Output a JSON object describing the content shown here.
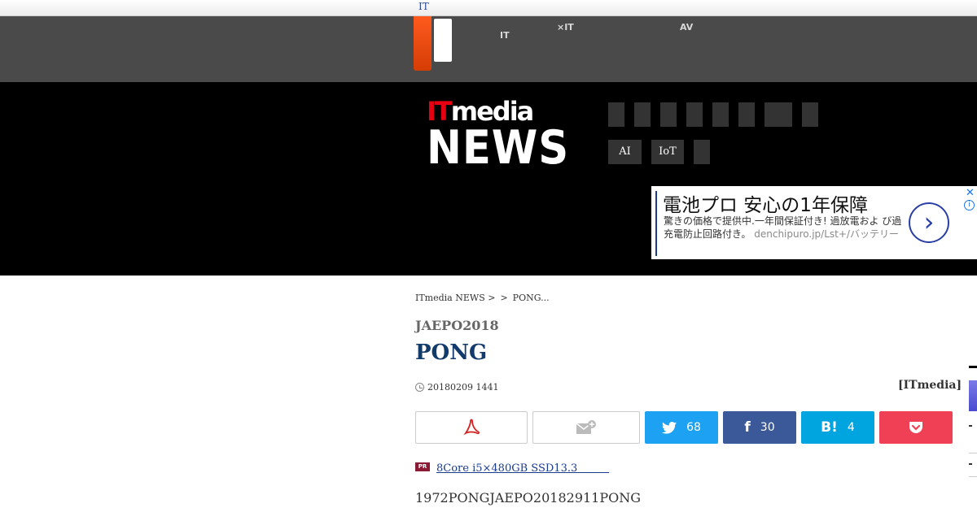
{
  "topbar": {
    "it_label": "IT"
  },
  "nav": {
    "items": [
      {
        "line1": "",
        "line2": "IT"
      },
      {
        "line1": "",
        "line2": "×IT"
      },
      {
        "line1": "AV",
        "line2": ""
      }
    ]
  },
  "brand": {
    "line1_red": "IT",
    "line1_white": "media",
    "line2": "NEWS"
  },
  "tags": {
    "ai": "AI",
    "iot": "IoT"
  },
  "ad": {
    "headline": "電池プロ 安心の1年保障",
    "body": "驚きの価格で提供中.一年間保証付き! 過放電およ び過充電防止回路付き。",
    "url": "denchipuro.jp/Lst+/バッテリー",
    "arrow": "›",
    "close": "✕",
    "info": "i"
  },
  "breadcrumb": {
    "home": "ITmedia NEWS >",
    "sep": ">",
    "current": "PONG..."
  },
  "article": {
    "series": "JAEPO2018",
    "title": "PONG",
    "date": "20180209 1441",
    "author": "[ITmedia]",
    "lead": "1972PONGJAEPO20182911PONG"
  },
  "share": {
    "twitter": "68",
    "facebook": "30",
    "hatena": "4"
  },
  "pr": {
    "badge": "PR",
    "link": "8Core i5×480GB SSD13.3　　　"
  },
  "colors": {
    "twitter": "#1da1f2",
    "facebook": "#3b5998",
    "hatena": "#00a4de",
    "pocket": "#ef4056",
    "logo_orange": "#ff5a1e"
  }
}
